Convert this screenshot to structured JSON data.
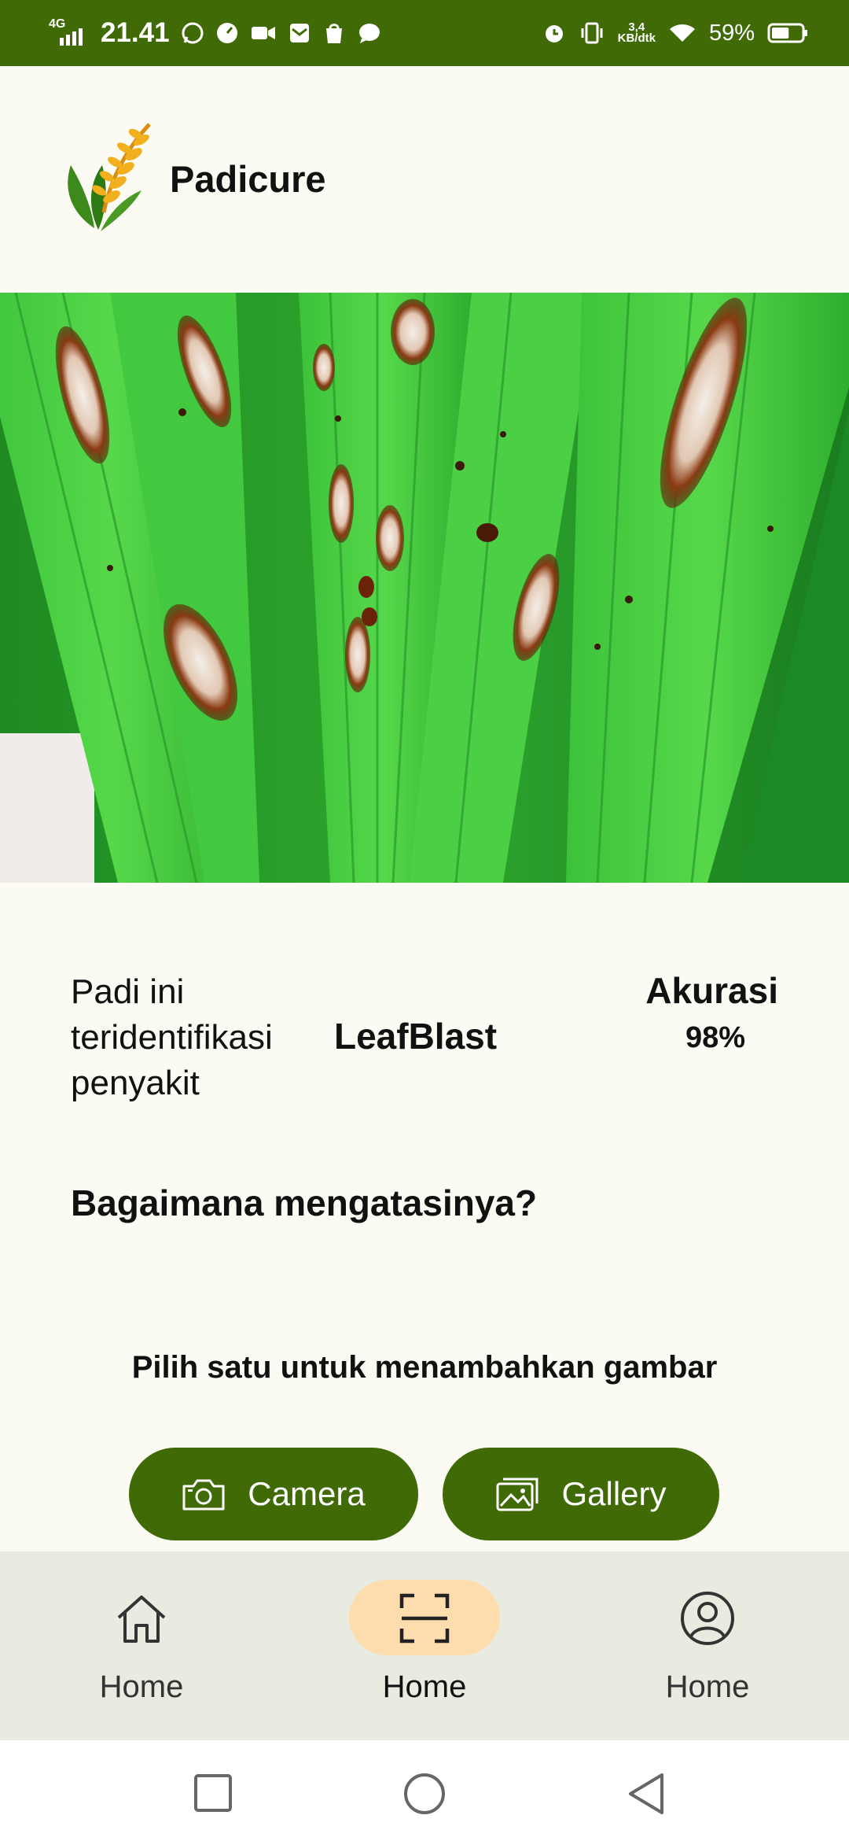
{
  "status_bar": {
    "network": "4G",
    "time": "21.41",
    "speed_value": "3,4",
    "speed_unit": "KB/dtk",
    "battery_percent": "59%",
    "battery_level": 0.59
  },
  "app": {
    "title": "Padicure"
  },
  "result": {
    "prefix": "Padi ini teridentifikasi penyakit",
    "disease": "LeafBlast",
    "accuracy_label": "Akurasi",
    "accuracy_value": "98%"
  },
  "question": "Bagaimana mengatasinya?",
  "prompt": "Pilih satu untuk menambahkan gambar",
  "buttons": {
    "camera": "Camera",
    "gallery": "Gallery"
  },
  "bottom_nav": [
    {
      "label": "Home",
      "icon": "home-icon",
      "active": false
    },
    {
      "label": "Home",
      "icon": "scan-icon",
      "active": true
    },
    {
      "label": "Home",
      "icon": "profile-icon",
      "active": false
    }
  ],
  "colors": {
    "primary": "#3f6a06",
    "active_pill": "#fddcae",
    "background": "#fcfbf3",
    "nav_background": "#e8ebdf"
  }
}
